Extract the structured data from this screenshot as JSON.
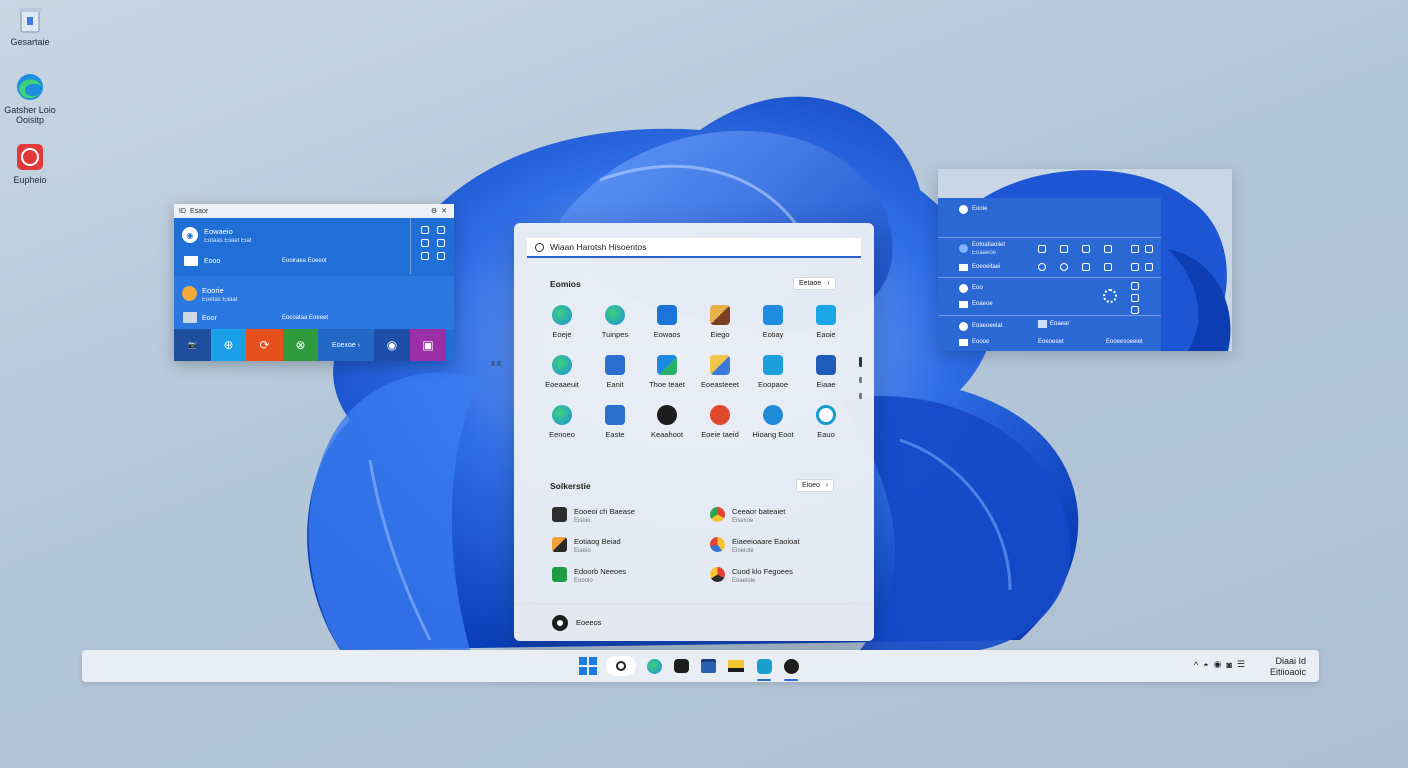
{
  "desktop": {
    "icons": [
      {
        "label": "Gesartaie",
        "icon": "recycle-bin-icon"
      },
      {
        "label": "Gatsher Loio Ooisitp",
        "icon": "edge-icon"
      },
      {
        "label": "Eupheio",
        "icon": "red-app-icon"
      }
    ]
  },
  "left_window": {
    "title": "Esaor",
    "title_icon": "ID",
    "rows": [
      {
        "title": "Eowaeio",
        "sub": "Eotaas Eiiaet Eiaf"
      },
      {
        "title": "Eooo",
        "sub": "Eooiraea Eoeeot"
      },
      {
        "title": "Eoorie",
        "sub": "Eoetas Eiiaat"
      },
      {
        "title": "Eoor",
        "sub": "Eocoataa Eoeeet"
      }
    ],
    "tile_label": "Eoexoe"
  },
  "start_menu": {
    "search_placeholder": "Wiaan Harotsh Hisoentos",
    "pinned_heading": "Eomios",
    "pinned_button": "Eetaoe",
    "pinned_button_glyph": "›",
    "pinned_apps": [
      {
        "name": "Eoeje",
        "icon": "edge-icon"
      },
      {
        "name": "Tuinpes",
        "icon": "edge-icon"
      },
      {
        "name": "Eowaos",
        "icon": "mail-icon"
      },
      {
        "name": "Eiego",
        "icon": "office-icon"
      },
      {
        "name": "Eotiay",
        "icon": "store-icon"
      },
      {
        "name": "Eaoie",
        "icon": "store-icon"
      },
      {
        "name": "Eoeaaeuit",
        "icon": "edge-icon"
      },
      {
        "name": "Eanit",
        "icon": "mail-icon"
      },
      {
        "name": "Thoe teaet",
        "icon": "photos-icon"
      },
      {
        "name": "Eoeasteeet",
        "icon": "office-icon"
      },
      {
        "name": "Eoopaoe",
        "icon": "store-icon"
      },
      {
        "name": "Eiaae",
        "icon": "calendar-icon"
      },
      {
        "name": "Eenoeo",
        "icon": "edge-icon"
      },
      {
        "name": "Easte",
        "icon": "settings-icon"
      },
      {
        "name": "Keaahoot",
        "icon": "camera-icon"
      },
      {
        "name": "Eoeie taeid",
        "icon": "media-icon"
      },
      {
        "name": "Hioang Eoot",
        "icon": "maps-icon"
      },
      {
        "name": "Eauo",
        "icon": "cortana-icon"
      }
    ],
    "page_dots": "8 8",
    "recommended_heading": "Solkerstie",
    "recommended_button": "Eioeo",
    "recommended_button_glyph": "›",
    "recommended": [
      {
        "title": "Eooeoi ch Baease",
        "sub": "Eisoio"
      },
      {
        "title": "Ceeaor bateaiet",
        "sub": "Eisexoe"
      },
      {
        "title": "Eotiaog Beiad",
        "sub": "Eiaeio"
      },
      {
        "title": "Eiaeeioaare Eaoioat",
        "sub": "Eioeiote"
      },
      {
        "title": "Edoorb Neeoes",
        "sub": "Eoooio"
      },
      {
        "title": "Cuod klo Fegoees",
        "sub": "Eoaeioie"
      }
    ],
    "user_name": "Eoeeos"
  },
  "right_window": {
    "rows": [
      {
        "title": "Eooie"
      },
      {
        "title": "Eotoatiaoiiet",
        "sub": "Eoaaeoe"
      },
      {
        "title": "Eoeoeitaei"
      },
      {
        "title": "Eoo"
      },
      {
        "title": "Eoaeoe"
      },
      {
        "title": "Eoaeoeeiat",
        "mid": "Eoaear"
      },
      {
        "title": "Eoooe",
        "mid": "Eoeoeeet",
        "right": "Eooeesoeeiet"
      }
    ]
  },
  "taskbar": {
    "tray_chevron": "^",
    "clock_time": "Diaai Id",
    "clock_date": "Eitiioaoic"
  },
  "colors": {
    "accent": "#2a6fd6",
    "window_blue": "#1f6fd6",
    "start_bg": "#eceff5"
  }
}
